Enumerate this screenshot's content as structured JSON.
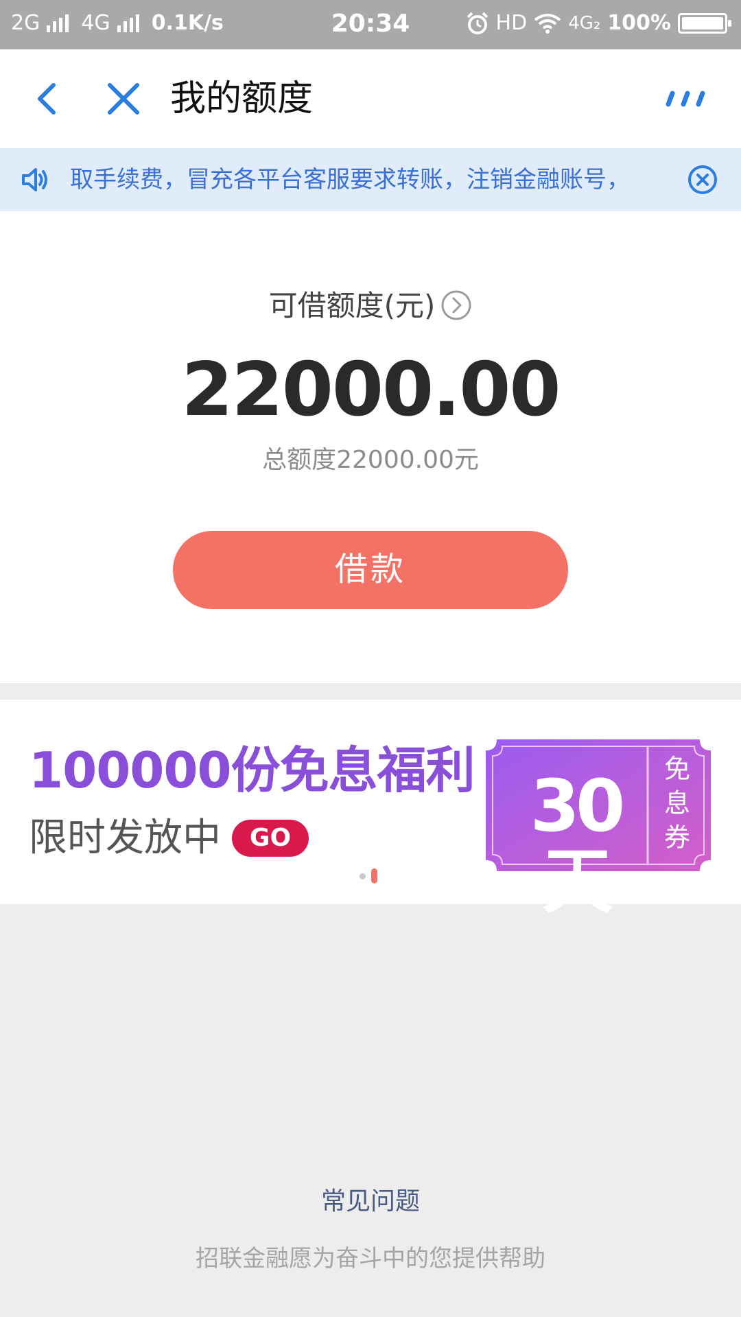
{
  "status_bar": {
    "net1": "2G",
    "net2": "4G",
    "speed": "0.1K/s",
    "time": "20:34",
    "hd": "HD",
    "net3": "4G₂",
    "battery_text": "100%",
    "battery_level": 1.0
  },
  "nav": {
    "title": "我的额度",
    "back_icon": "chevron-left-icon",
    "close_icon": "close-icon",
    "more_icon": "more-dots-icon"
  },
  "notice": {
    "text": "\u0000取手续费，冒充各平台客服要求转账，注销金融账号，",
    "speaker_icon": "speaker-icon",
    "close_icon": "close-circle-icon"
  },
  "credit": {
    "label": "可借额度(元)",
    "amount": "22000.00",
    "total": "总额度22000.00元",
    "borrow_label": "借款"
  },
  "promo": {
    "headline": "100000份免息福利",
    "subline": "限时发放中",
    "go_label": "GO",
    "coupon_days": "30天",
    "coupon_side": [
      "免",
      "息",
      "券"
    ],
    "slides": 2,
    "active_slide": 2
  },
  "footer": {
    "faq": "常见问题",
    "slogan": "招联金融愿为奋斗中的您提供帮助"
  },
  "colors": {
    "accent_blue": "#2b7de0",
    "borrow_button": "#f47165",
    "promo_purple": "#8a4fd8",
    "go_red": "#d9184b"
  }
}
